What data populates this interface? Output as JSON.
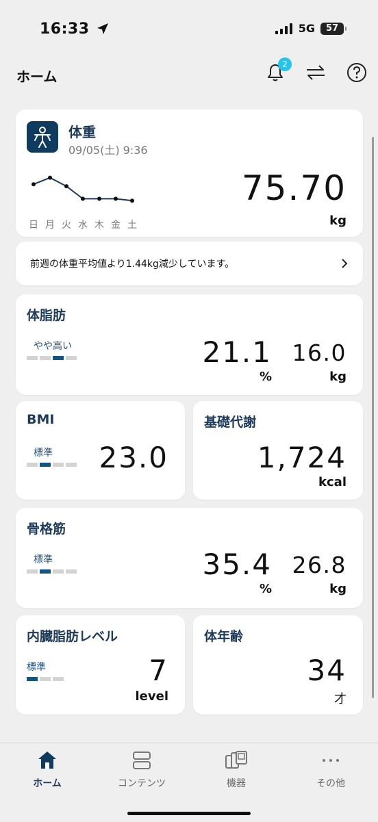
{
  "status": {
    "time": "16:33",
    "network": "5G",
    "battery": "57"
  },
  "header": {
    "title": "ホーム",
    "notification_count": "2"
  },
  "weight": {
    "title": "体重",
    "datetime": "09/05(土) 9:36",
    "value": "75.70",
    "unit": "kg",
    "days": [
      "日",
      "月",
      "火",
      "水",
      "木",
      "金",
      "土"
    ]
  },
  "message": {
    "text": "前週の体重平均値より1.44kg減少しています。"
  },
  "body_fat": {
    "title": "体脂肪",
    "level": "やや高い",
    "level_index": 3,
    "percent": "21.1",
    "percent_unit": "%",
    "mass": "16.0",
    "mass_unit": "kg"
  },
  "bmi": {
    "title": "BMI",
    "level": "標準",
    "level_index": 2,
    "value": "23.0"
  },
  "bmr": {
    "title": "基礎代謝",
    "value": "1,724",
    "unit": "kcal"
  },
  "muscle": {
    "title": "骨格筋",
    "level": "標準",
    "level_index": 2,
    "percent": "35.4",
    "percent_unit": "%",
    "mass": "26.8",
    "mass_unit": "kg"
  },
  "visceral": {
    "title": "内臓脂肪レベル",
    "level": "標準",
    "level_index": 1,
    "value": "7",
    "unit": "level"
  },
  "body_age": {
    "title": "体年齢",
    "value": "34",
    "unit": "才"
  },
  "tabs": [
    {
      "label": "ホーム",
      "icon": "home-icon"
    },
    {
      "label": "コンテンツ",
      "icon": "contents-icon"
    },
    {
      "label": "機器",
      "icon": "devices-icon"
    },
    {
      "label": "その他",
      "icon": "more-icon"
    }
  ],
  "chart_data": {
    "type": "line",
    "categories": [
      "日",
      "月",
      "火",
      "水",
      "木",
      "金",
      "土"
    ],
    "series": [
      {
        "values": [
          77.6,
          78.6,
          77.3,
          75.4,
          75.4,
          75.4,
          75.1
        ]
      }
    ],
    "ylim": [
      74.5,
      79.5
    ]
  }
}
